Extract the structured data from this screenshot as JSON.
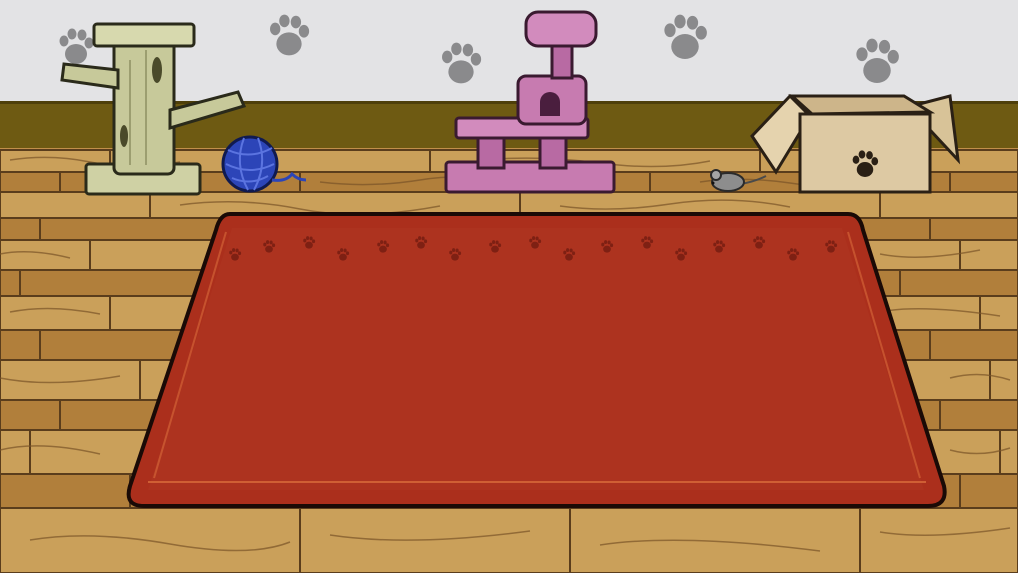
{
  "scene": {
    "name": "cat-room",
    "palette": {
      "wall": "#e3e3e5",
      "wall_trim": "#6e5a12",
      "floor_light": "#c99a52",
      "floor_mid": "#b5843e",
      "floor_line": "#5a3d1c",
      "rug": "#ab2f1c",
      "rug_edge": "#8c2212",
      "rug_stitch": "#d96a3a",
      "paw_wall": "#8a8a8c",
      "paw_rug": "#7a1e12",
      "scratch_post": "#cfd1a4",
      "cat_tree": "#c77bb0",
      "yarn": "#2c45b8",
      "box": "#ddc9a3",
      "mouse": "#8d8d8d"
    },
    "objects": [
      {
        "id": "scratching-post",
        "icon": "scratching-post-icon"
      },
      {
        "id": "yarn-ball",
        "icon": "yarn-ball-icon"
      },
      {
        "id": "cat-tree",
        "icon": "cat-tree-icon"
      },
      {
        "id": "toy-mouse",
        "icon": "toy-mouse-icon"
      },
      {
        "id": "cardboard-box",
        "icon": "cardboard-box-icon"
      },
      {
        "id": "red-rug",
        "icon": "rug-icon"
      }
    ]
  }
}
